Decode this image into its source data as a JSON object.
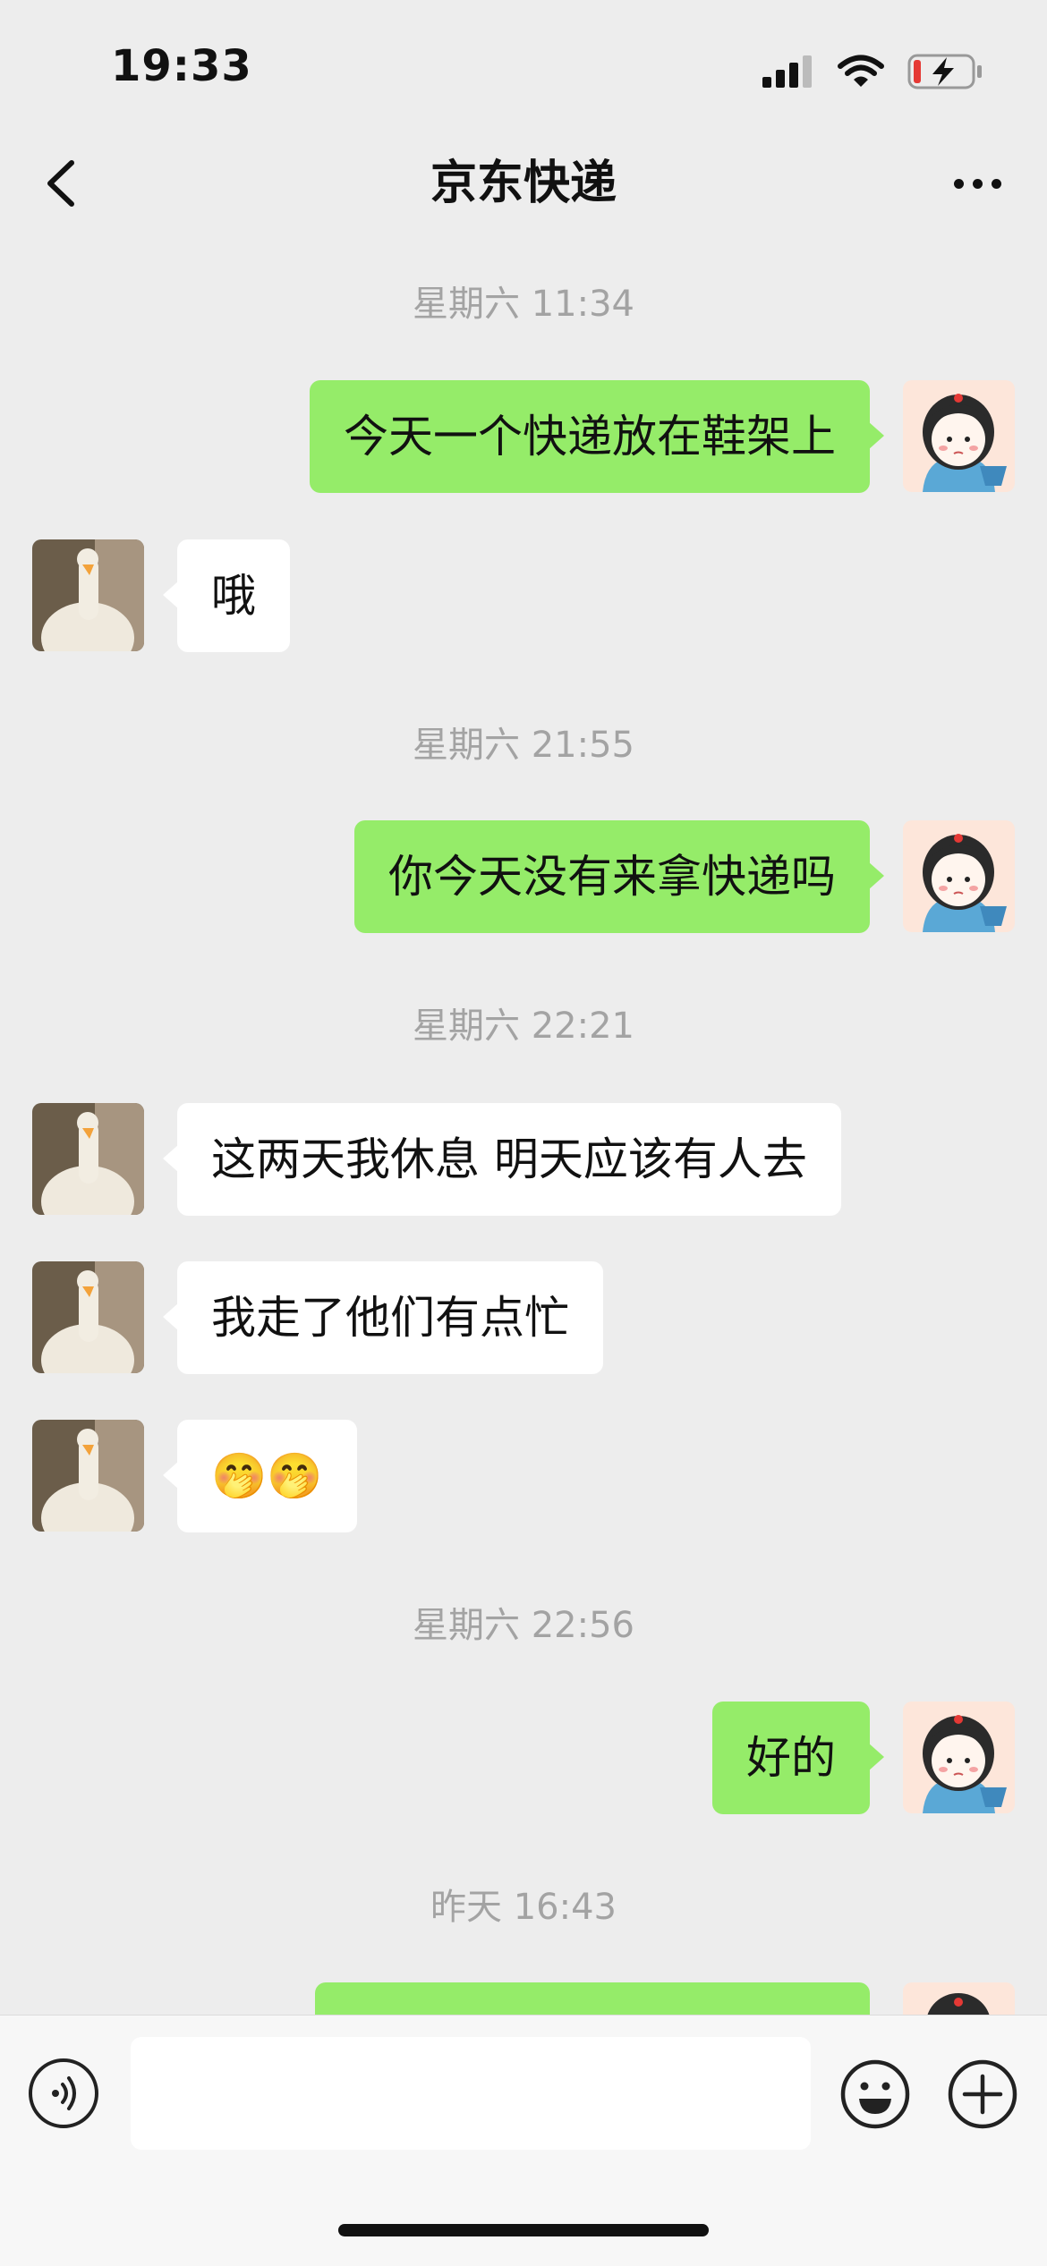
{
  "status_bar": {
    "time": "19:33"
  },
  "nav": {
    "title": "京东快递"
  },
  "messages": {
    "ts1": "星期六 11:34",
    "m1": "今天一个快递放在鞋架上",
    "m2": "哦",
    "ts2": "星期六 21:55",
    "m3": "你今天没有来拿快递吗",
    "ts3": "星期六 22:21",
    "m4": "这两天我休息 明天应该有人去",
    "m5": "我走了他们有点忙",
    "m6": "🤭🤭",
    "ts4": "星期六 22:56",
    "m7": "好的",
    "ts5": "昨天 16:43"
  },
  "input": {
    "value": "",
    "placeholder": ""
  },
  "colors": {
    "outgoing_bubble": "#95ec69",
    "incoming_bubble": "#ffffff",
    "background": "#ededed"
  },
  "icons": [
    "chevron-left-icon",
    "more-dots-icon",
    "voice-icon",
    "emoji-icon",
    "plus-icon",
    "signal-icon",
    "wifi-icon",
    "battery-icon"
  ]
}
